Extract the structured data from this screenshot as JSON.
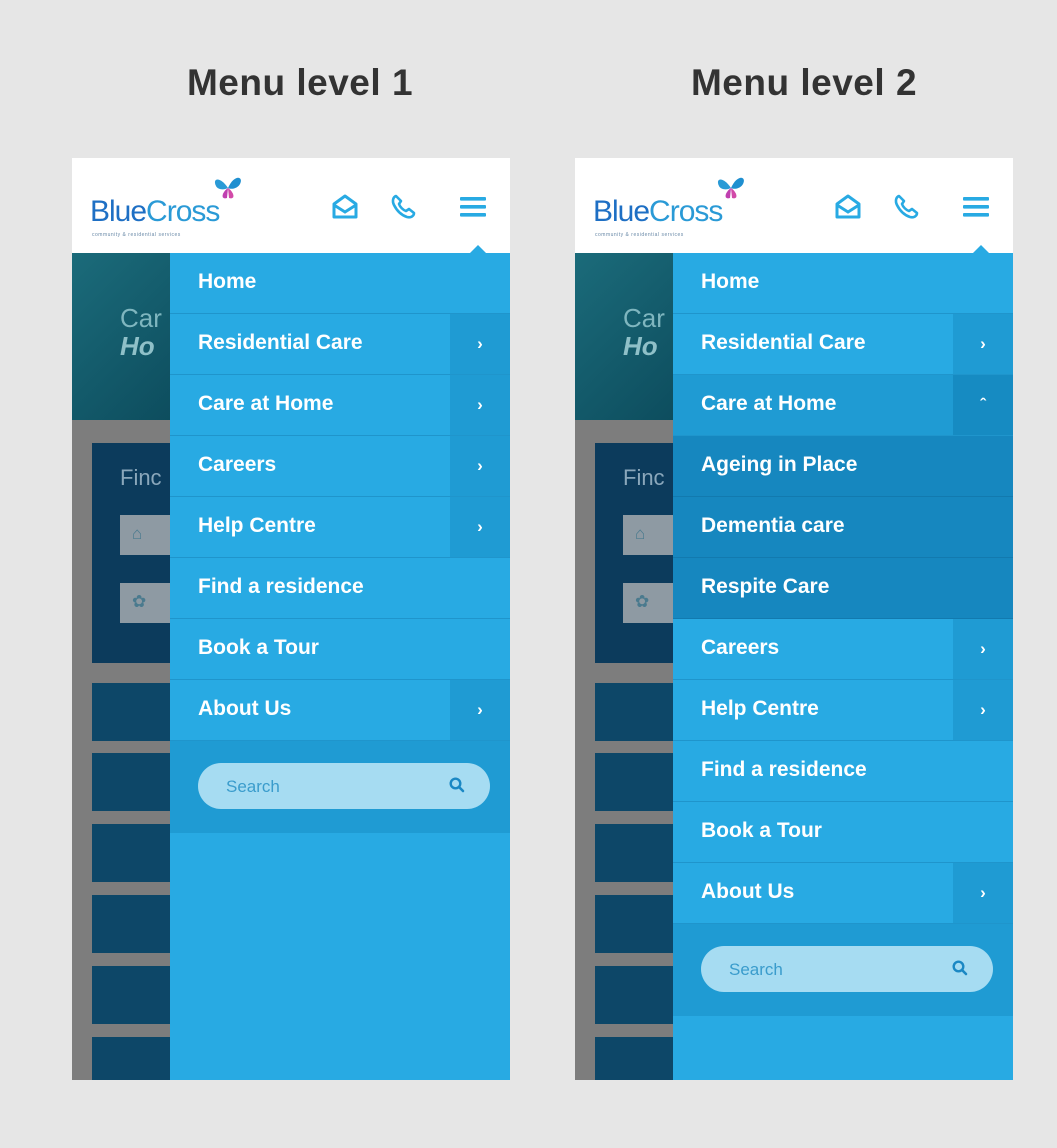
{
  "titles": {
    "left": "Menu level 1",
    "right": "Menu level 2"
  },
  "brand": {
    "name_part1": "Blue",
    "name_part2": "Cross",
    "tagline": "community & residential services",
    "blue": "#2a7fd0",
    "butterfly_colors": [
      "#2a9ad6",
      "#c040b0"
    ]
  },
  "header_icons": [
    "mail-icon",
    "phone-icon",
    "hamburger-menu-icon"
  ],
  "background_page": {
    "hero_line1": "Car",
    "hero_line2": "Ho",
    "find_label": "Finc"
  },
  "colors": {
    "menu_bg": "#28aae3",
    "menu_arrow_bg": "#1f9bd3",
    "submenu_bg": "#1687bf",
    "search_bg": "#a6dcf2"
  },
  "menu_level1": {
    "items": [
      {
        "label": "Home",
        "has_arrow": false
      },
      {
        "label": "Residential Care",
        "has_arrow": true,
        "arrow": "›"
      },
      {
        "label": "Care at Home",
        "has_arrow": true,
        "arrow": "›"
      },
      {
        "label": "Careers",
        "has_arrow": true,
        "arrow": "›"
      },
      {
        "label": "Help Centre",
        "has_arrow": true,
        "arrow": "›"
      },
      {
        "label": "Find a residence",
        "has_arrow": false
      },
      {
        "label": "Book a Tour",
        "has_arrow": false
      },
      {
        "label": "About Us",
        "has_arrow": true,
        "arrow": "›"
      }
    ],
    "search_placeholder": "Search"
  },
  "menu_level2": {
    "items": [
      {
        "label": "Home",
        "has_arrow": false
      },
      {
        "label": "Residential Care",
        "has_arrow": true,
        "arrow": "›"
      },
      {
        "label": "Care at Home",
        "has_arrow": true,
        "arrow": "ˆ",
        "expanded": true
      },
      {
        "label": "Ageing in Place",
        "submenu": true
      },
      {
        "label": "Dementia care",
        "submenu": true
      },
      {
        "label": "Respite Care",
        "submenu": true
      },
      {
        "label": "Careers",
        "has_arrow": true,
        "arrow": "›"
      },
      {
        "label": "Help Centre",
        "has_arrow": true,
        "arrow": "›"
      },
      {
        "label": "Find a residence",
        "has_arrow": false
      },
      {
        "label": "Book a Tour",
        "has_arrow": false
      },
      {
        "label": "About Us",
        "has_arrow": true,
        "arrow": "›"
      }
    ],
    "search_placeholder": "Search"
  }
}
